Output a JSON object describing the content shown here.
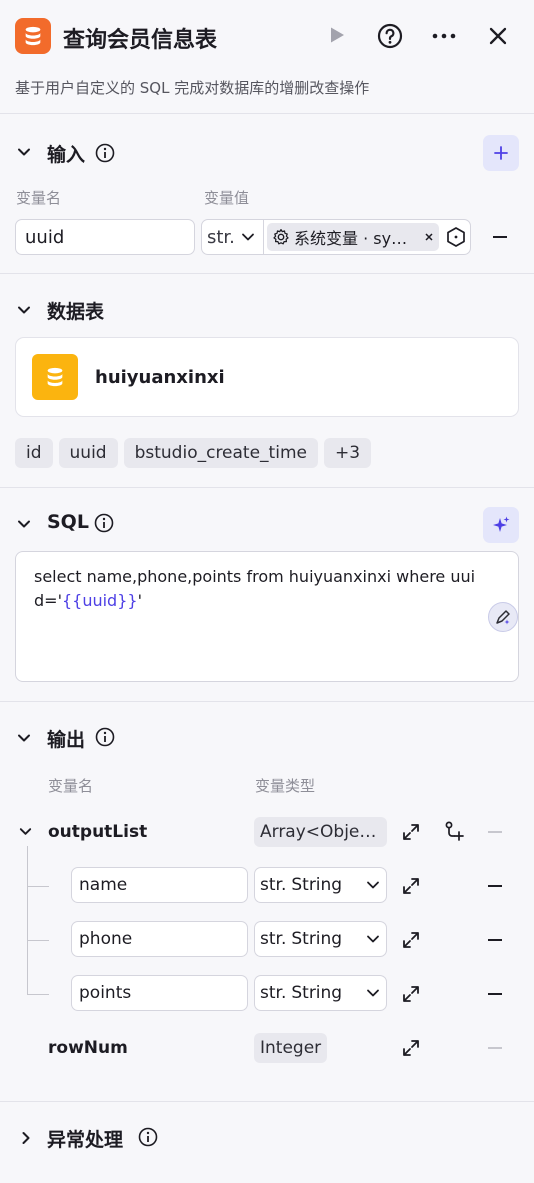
{
  "header": {
    "title": "查询会员信息表",
    "description": "基于用户自定义的 SQL 完成对数据库的增删改查操作",
    "accent": "#f26b2b"
  },
  "input": {
    "title": "输入",
    "col_name": "变量名",
    "col_value": "变量值",
    "row": {
      "name": "uuid",
      "type": "str.",
      "ref_label": "系统变量 · sy…"
    }
  },
  "database": {
    "title": "数据表",
    "table_name": "huiyuanxinxi",
    "table_icon_color": "#fbb40f",
    "fields": [
      "id",
      "uuid",
      "bstudio_create_time",
      "+3"
    ]
  },
  "sql": {
    "title": "SQL",
    "line1": "select name,phone,points from huiyuanxinxi where uui",
    "line2_prefix": "d='",
    "line2_var": "{{uuid}}",
    "line2_suffix": "'",
    "var_color": "#4e40e5"
  },
  "output": {
    "title": "输出",
    "col_name": "变量名",
    "col_type": "变量类型",
    "list_name": "outputList",
    "list_type": "Array<Obje…",
    "children": [
      {
        "name": "name",
        "type_prefix": "str.",
        "type": "String"
      },
      {
        "name": "phone",
        "type_prefix": "str.",
        "type": "String"
      },
      {
        "name": "points",
        "type_prefix": "str.",
        "type": "String"
      }
    ],
    "rownum_name": "rowNum",
    "rownum_type": "Integer"
  },
  "exception": {
    "title": "异常处理"
  }
}
